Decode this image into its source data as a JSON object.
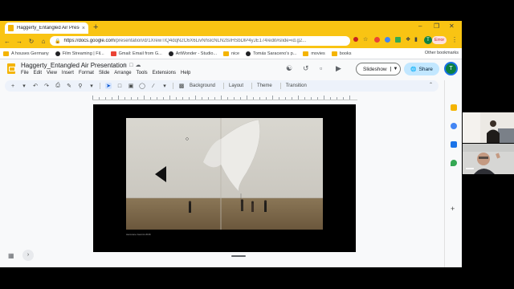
{
  "browser": {
    "tab_title": "Haggerty_Entangled Air Presentatio",
    "tab_close": "×",
    "new_tab": "+",
    "win_min": "–",
    "win_max": "❐",
    "win_close": "✕",
    "url_host": "https://docs.google.com",
    "url_path": "/presentation/d/1XrewTlQ4dqN2C6X6LivNhslcNLN2tsIHSbDlP4yJE174/edit#slide=id.g2...",
    "profile_initial": "T",
    "profile_status": "Error",
    "bookmarks": [
      {
        "label": "A houses Germany",
        "icon": "folder"
      },
      {
        "label": "Film Streaming | Fil...",
        "icon": "round"
      },
      {
        "label": "Gmail: Email from G...",
        "icon": "gmail"
      },
      {
        "label": "ArtWonder - Studio...",
        "icon": "round"
      },
      {
        "label": "nice",
        "icon": "folder"
      },
      {
        "label": "Tomás Saraceno's p...",
        "icon": "round"
      },
      {
        "label": "movies",
        "icon": "folder"
      },
      {
        "label": "books",
        "icon": "folder"
      }
    ],
    "other_bookmarks": "Other bookmarks"
  },
  "docs": {
    "title": "Haggerty_Entangled Air Presentation",
    "menus": [
      "File",
      "Edit",
      "View",
      "Insert",
      "Format",
      "Slide",
      "Arrange",
      "Tools",
      "Extensions",
      "Help"
    ],
    "slideshow_label": "Slideshow",
    "share_label": "Share",
    "avatar_initial": "T"
  },
  "toolbar": {
    "background_label": "Background",
    "layout_label": "Layout",
    "theme_label": "Theme",
    "transition_label": "Transition"
  },
  "slide": {
    "caption": "Aerocene Gemini 2016"
  },
  "colors": {
    "chrome_accent": "#f9c413",
    "share_bg": "#c2e7ff",
    "avatar_green": "#0b8043",
    "slide_bg": "#000000"
  }
}
